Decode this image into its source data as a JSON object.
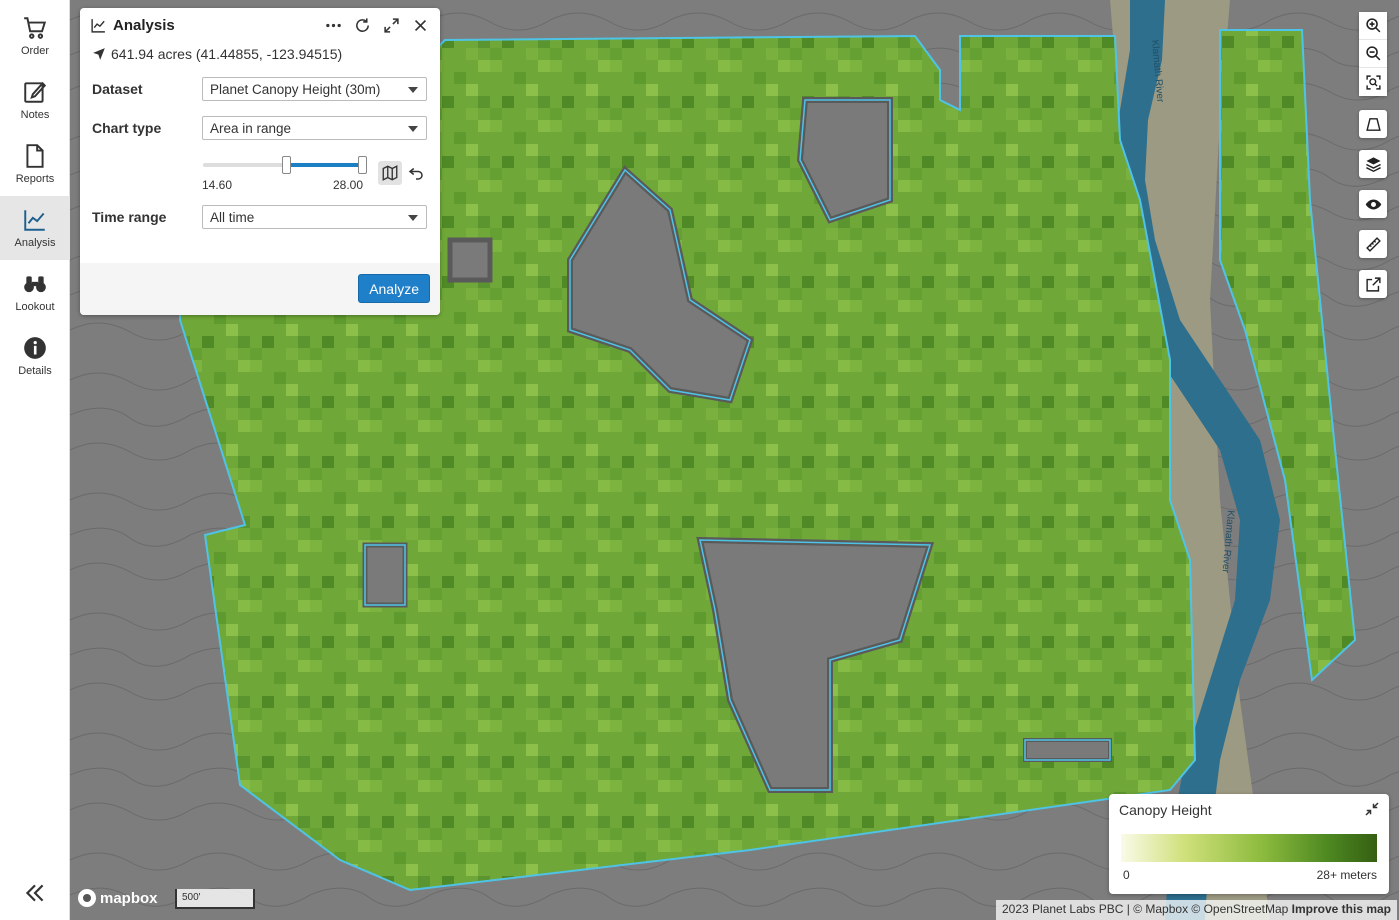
{
  "nav": {
    "items": [
      {
        "label": "Order",
        "icon": "cart-icon"
      },
      {
        "label": "Notes",
        "icon": "edit-note-icon"
      },
      {
        "label": "Reports",
        "icon": "document-icon"
      },
      {
        "label": "Analysis",
        "icon": "chart-line-icon",
        "active": true
      },
      {
        "label": "Lookout",
        "icon": "binoculars-icon"
      },
      {
        "label": "Details",
        "icon": "info-icon"
      }
    ],
    "collapse_icon": "double-chevron-left-icon"
  },
  "panel": {
    "title": "Analysis",
    "location": "641.94 acres (41.44855, -123.94515)",
    "dataset_label": "Dataset",
    "dataset_value": "Planet Canopy Height (30m)",
    "chart_type_label": "Chart type",
    "chart_type_value": "Area in range",
    "range_min": "14.60",
    "range_max": "28.00",
    "range_low_fraction": 0.52,
    "range_high_fraction": 1.0,
    "time_range_label": "Time range",
    "time_range_value": "All time",
    "analyze_label": "Analyze"
  },
  "legend": {
    "title": "Canopy Height",
    "min": "0",
    "max": "28+ meters",
    "colors": [
      "#fafbe8",
      "#cfe07a",
      "#8dbb3e",
      "#4f8a22",
      "#355f12"
    ]
  },
  "map": {
    "river_labels": [
      "Klamath River",
      "Klamath River"
    ],
    "scale": "500'",
    "logo": "mapbox",
    "attribution": "2023 Planet Labs PBC | © Mapbox © OpenStreetMap",
    "improve_link": "Improve this map",
    "boundary_color": "#4fc3e6",
    "water_color": "#2e6f8e"
  }
}
